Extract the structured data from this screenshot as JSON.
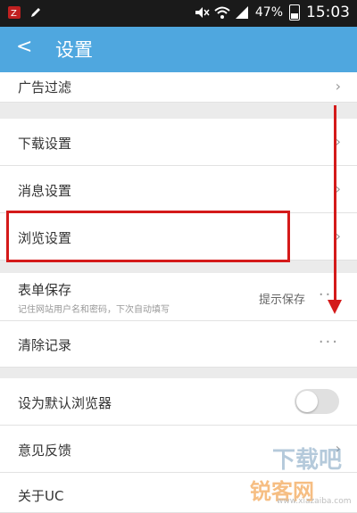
{
  "status_bar": {
    "battery": "47%",
    "time": "15:03",
    "battery_level": 0.47
  },
  "header": {
    "back_label": "<",
    "title": "设置"
  },
  "settings": {
    "ad_filter": "广告过滤",
    "download": "下载设置",
    "message": "消息设置",
    "browse": "浏览设置",
    "form_save": {
      "label": "表单保存",
      "sub": "记住网站用户名和密码，下次自动填写",
      "value": "提示保存"
    },
    "clear": "清除记录",
    "default_browser": {
      "label": "设为默认浏览器",
      "enabled": false
    },
    "feedback": "意见反馈",
    "about": "关于UC"
  },
  "watermark": {
    "big": "下载吧",
    "site": "锐客网",
    "url": "www.xiazaiba.com"
  },
  "icons": {
    "status_left": [
      "notification-icon",
      "edit-icon"
    ],
    "status_right": [
      "mute-icon",
      "wifi-icon",
      "signal-icon",
      "battery-icon"
    ]
  }
}
